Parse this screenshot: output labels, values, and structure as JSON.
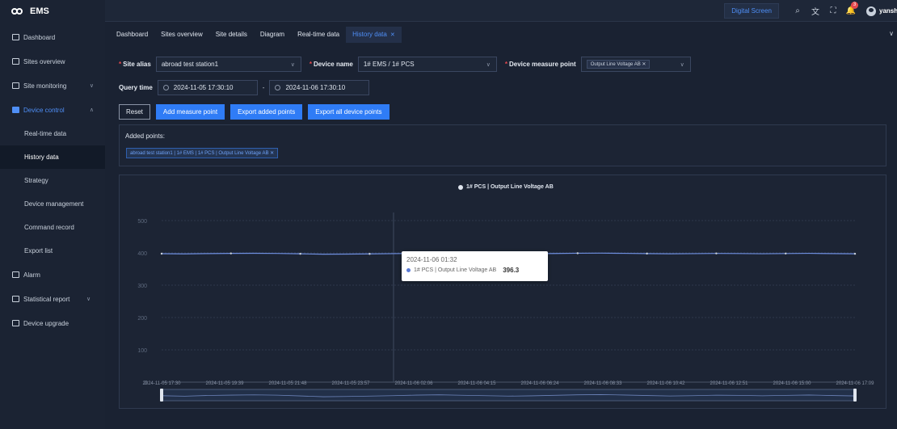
{
  "app": {
    "name": "EMS"
  },
  "header": {
    "digital_screen": "Digital Screen",
    "notification_count": "3",
    "username": "yanshi"
  },
  "sidebar": {
    "items": [
      {
        "label": "Dashboard"
      },
      {
        "label": "Sites overview"
      },
      {
        "label": "Site monitoring"
      },
      {
        "label": "Device control"
      },
      {
        "label": "Alarm"
      },
      {
        "label": "Statistical report"
      },
      {
        "label": "Device upgrade"
      }
    ],
    "device_control_subitems": [
      {
        "label": "Real-time data"
      },
      {
        "label": "History data"
      },
      {
        "label": "Strategy"
      },
      {
        "label": "Device management"
      },
      {
        "label": "Command record"
      },
      {
        "label": "Export list"
      }
    ]
  },
  "tabs": [
    {
      "label": "Dashboard"
    },
    {
      "label": "Sites overview"
    },
    {
      "label": "Site details"
    },
    {
      "label": "Diagram"
    },
    {
      "label": "Real-time data"
    },
    {
      "label": "History data"
    }
  ],
  "filters": {
    "site_alias_label": "Site alias",
    "site_alias_value": "abroad test station1",
    "device_name_label": "Device name",
    "device_name_value": "1# EMS / 1# PCS",
    "measure_point_label": "Device measure point",
    "measure_point_tag": "Output Line Voltage AB",
    "query_time_label": "Query time",
    "start_time": "2024-11-05 17:30:10",
    "range_separator": "-",
    "end_time": "2024-11-06 17:30:10"
  },
  "buttons": {
    "reset": "Reset",
    "add_point": "Add measure point",
    "export_added": "Export added points",
    "export_all": "Export all device points"
  },
  "added_points": {
    "title": "Added points:",
    "tags": [
      "abroad test station1 | 1# EMS | 1# PCS | Output Line Voltage AB"
    ]
  },
  "chart_data": {
    "type": "line",
    "title": "",
    "xlabel": "",
    "ylabel": "",
    "ylim": [
      0,
      500
    ],
    "y_ticks": [
      0,
      100,
      200,
      300,
      400,
      500
    ],
    "x_tick_labels": [
      "2024-11-05 17:30",
      "2024-11-05 19:39",
      "2024-11-05 21:48",
      "2024-11-05 23:57",
      "2024-11-06 02:06",
      "2024-11-06 04:15",
      "2024-11-06 06:24",
      "2024-11-06 08:33",
      "2024-11-06 10:42",
      "2024-11-06 12:51",
      "2024-11-06 15:00",
      "2024-11-06 17:09"
    ],
    "grid": true,
    "legend": "top-center",
    "series": [
      {
        "name": "1# PCS | Output Line Voltage AB",
        "color": "#6f8fe0",
        "values": [
          397.5,
          396.8,
          397.9,
          398.4,
          398.8,
          398.3,
          397.2,
          395.9,
          396.3,
          396.9,
          397.6,
          398.4,
          398.9,
          398.2,
          397.6,
          396.9,
          397.3,
          398.1,
          398.9,
          399.2,
          398.6,
          397.8,
          397.1,
          397.6,
          398.3,
          398.0,
          397.4,
          398.0,
          398.6,
          397.8,
          397.2
        ]
      }
    ],
    "tooltip": {
      "time": "2024-11-06 01:32",
      "series": "1# PCS | Output Line Voltage AB",
      "value": "396.3"
    }
  }
}
